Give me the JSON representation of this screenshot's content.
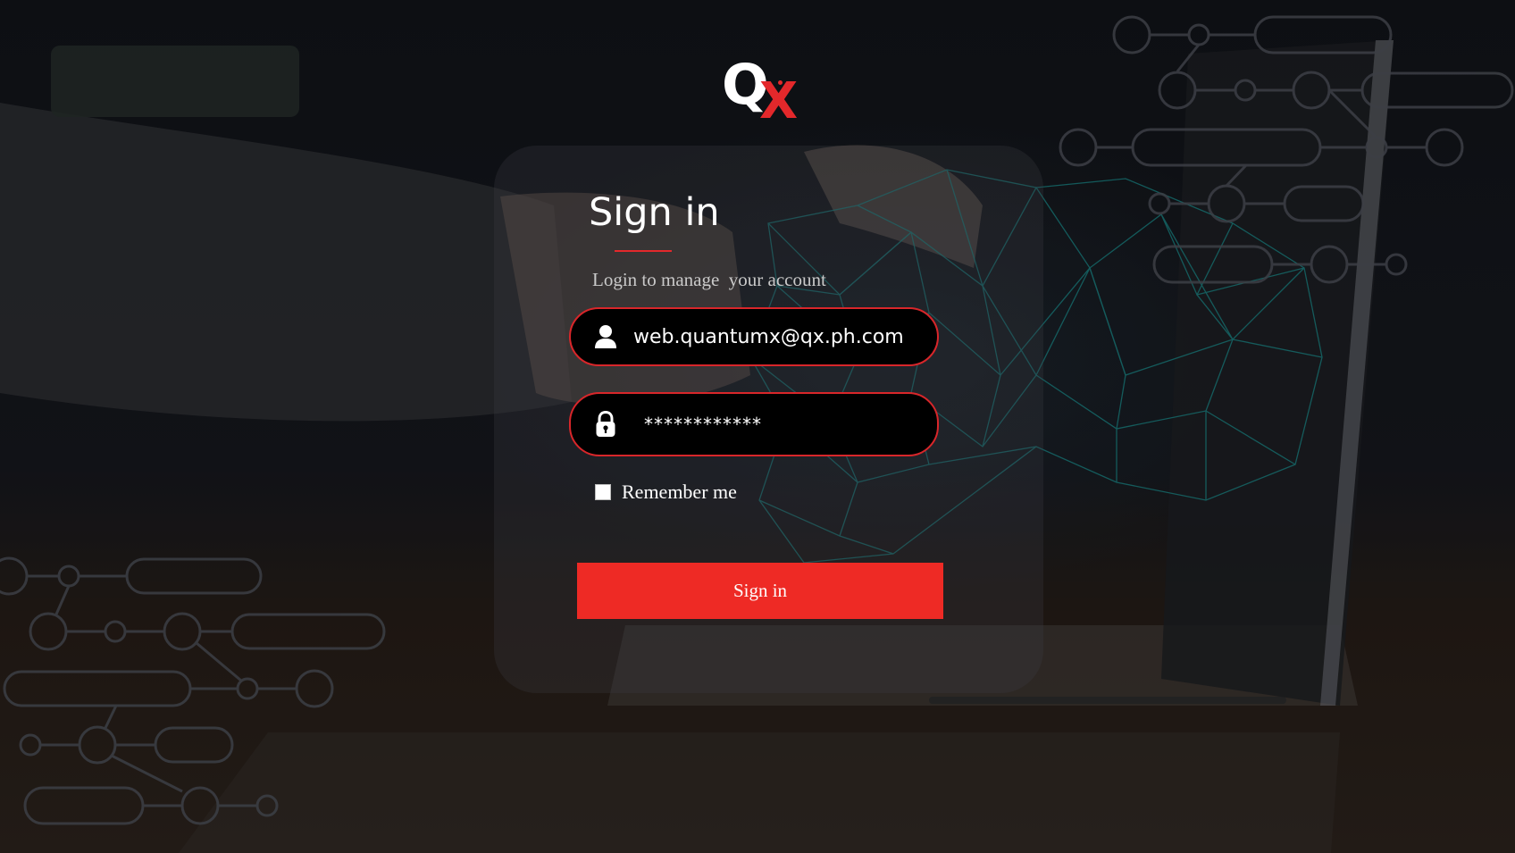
{
  "brand": {
    "logo_q": "Q",
    "logo_x": "X",
    "primary_color": "#ee2a25",
    "logo_icon": "qx-logo"
  },
  "login": {
    "title": "Sign in",
    "subtitle": "Login to manage  your account",
    "email": {
      "value": "web.quantumx@qx.ph.com",
      "icon": "user-icon"
    },
    "password": {
      "value": "************",
      "icon": "lock-icon"
    },
    "remember_me": {
      "label": "Remember me",
      "checked": false
    },
    "submit_label": "Sign in"
  }
}
